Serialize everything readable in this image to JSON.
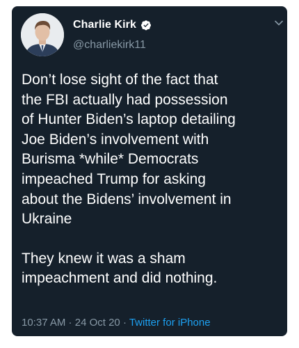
{
  "tweet": {
    "author": {
      "display_name": "Charlie Kirk",
      "handle": "@charliekirk11",
      "verified_icon": "verified-badge-icon"
    },
    "paragraphs": [
      "Don’t lose sight of the fact that\nthe FBI actually had possession\nof Hunter Biden’s laptop detailing\nJoe Biden’s involvement with\nBurisma *while* Democrats\nimpeached Trump for asking\nabout the Bidens’ involvement in\nUkraine",
      "They knew it was a sham\nimpeachment and did nothing."
    ],
    "time": "10:37 AM",
    "separator": " · ",
    "date": "24 Oct 20",
    "source": "Twitter for iPhone"
  },
  "colors": {
    "background": "#15202b",
    "text": "#ffffff",
    "muted": "#8899a6",
    "accent": "#1da1f2"
  }
}
